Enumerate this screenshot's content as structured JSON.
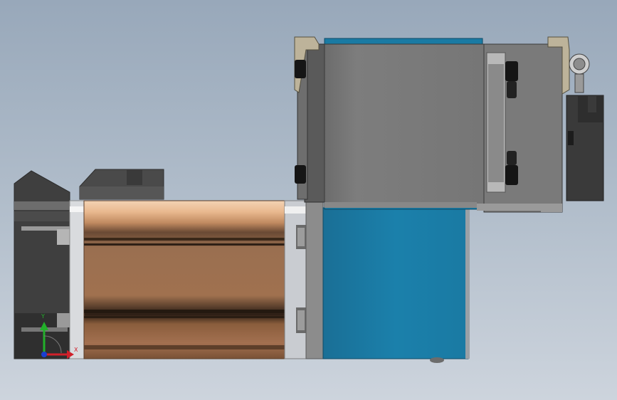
{
  "viewport": {
    "background_top": "#98a8ba",
    "background_bottom": "#cdd4dd"
  },
  "model": {
    "parts": [
      {
        "name": "motor-body",
        "color": "#a0714f"
      },
      {
        "name": "gearbox-housing",
        "color": "#1a7aa3"
      },
      {
        "name": "control-box",
        "color": "#777777"
      },
      {
        "name": "end-cap",
        "color": "#4a4a4a"
      }
    ]
  },
  "triad": {
    "x_label": "X",
    "y_label": "Y",
    "x_color": "#d0202a",
    "y_color": "#22b02a",
    "z_color": "#1a3fd0"
  }
}
